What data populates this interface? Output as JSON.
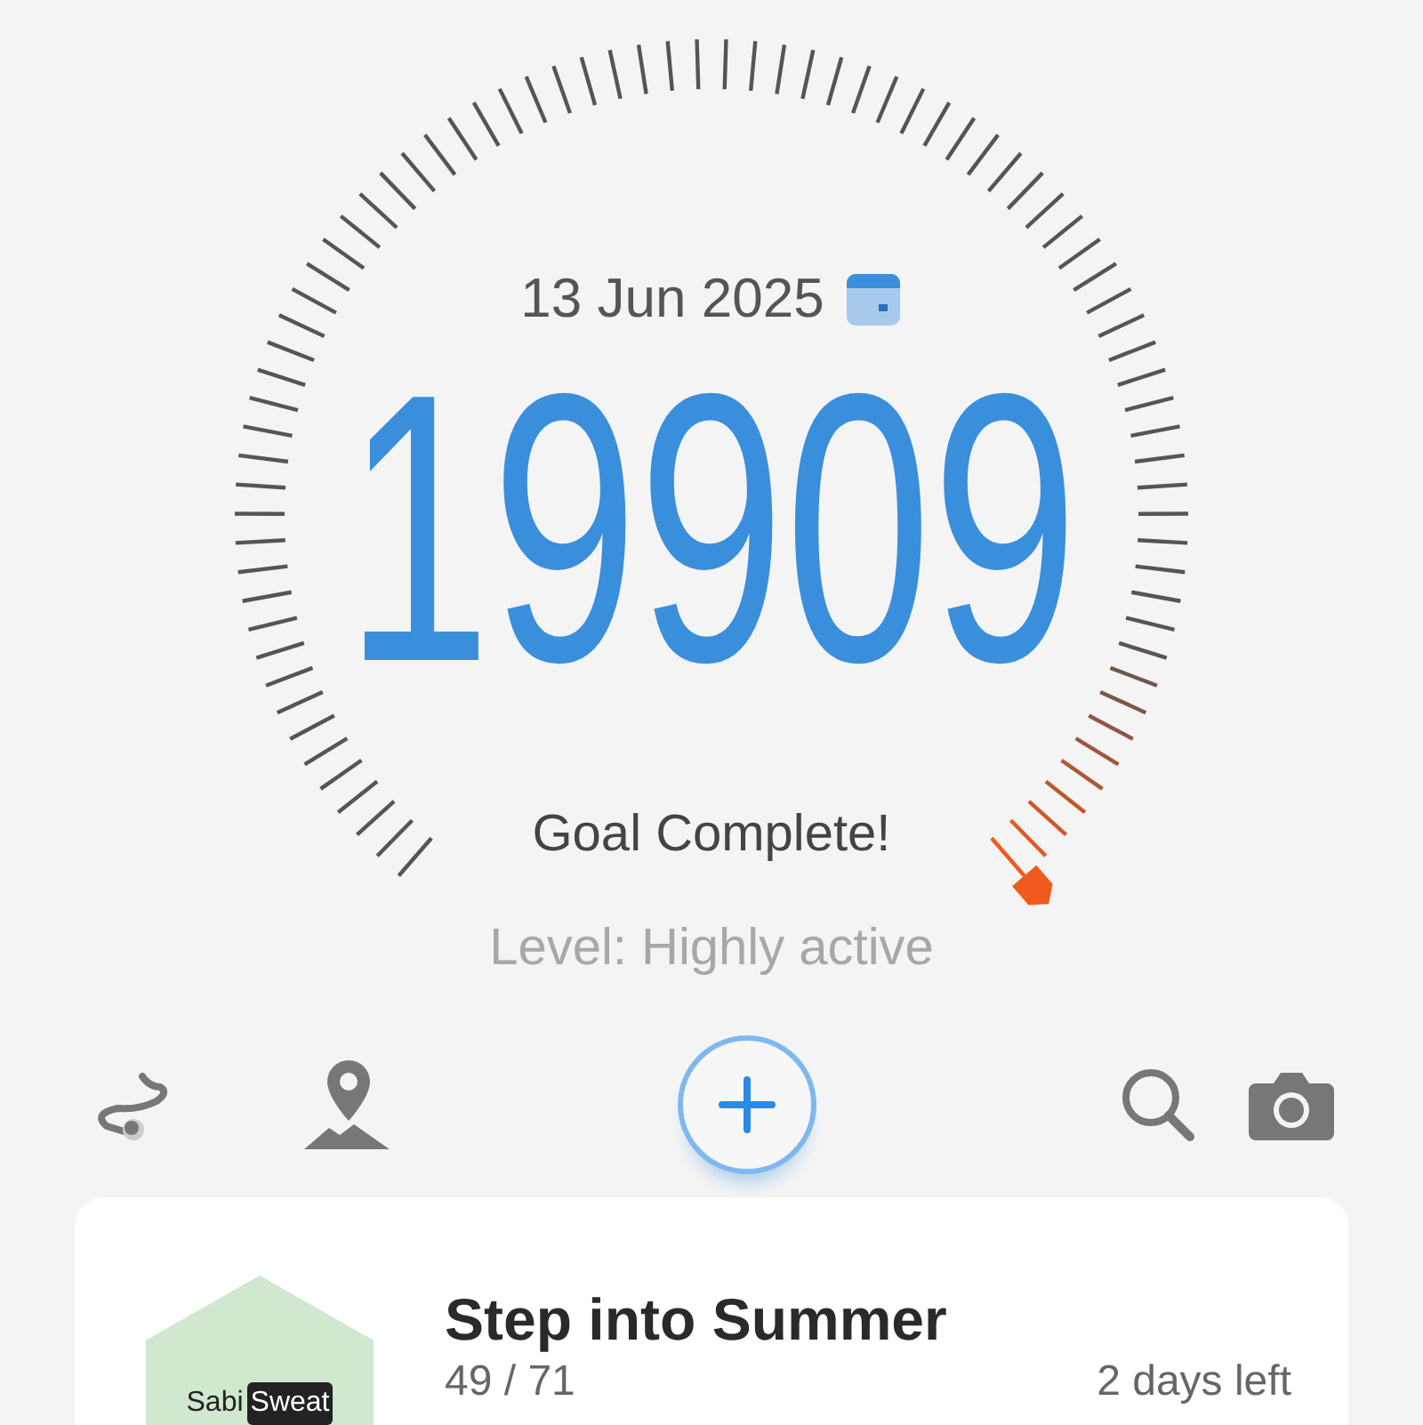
{
  "date": "13 Jun 2025",
  "steps": "19909",
  "status": "Goal Complete!",
  "activity_level": "Level: Highly active",
  "challenge": {
    "brand_left": "Sabi",
    "brand_right": "Sweat",
    "title": "Step into Summer",
    "progress": "49 / 71",
    "time_left": "2 days left"
  }
}
